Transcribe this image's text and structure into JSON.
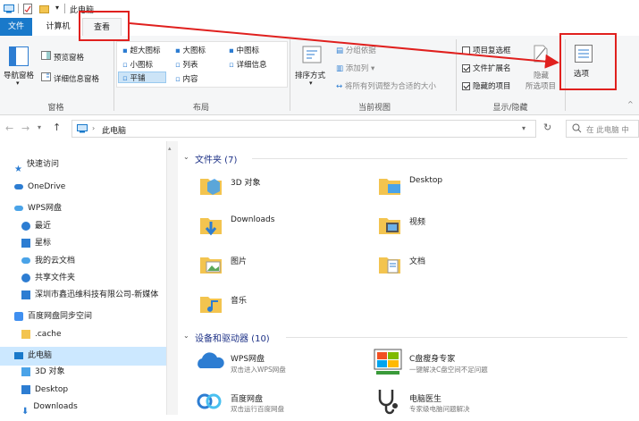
{
  "window": {
    "title": "此电脑"
  },
  "tabs": [
    "文件",
    "计算机",
    "查看"
  ],
  "ribbon": {
    "panes": {
      "nav_pane": "导航窗格",
      "preview_pane": "预览窗格",
      "details_pane": "详细信息窗格",
      "group_label": "窗格"
    },
    "layout": {
      "items": [
        "超大图标",
        "大图标",
        "中图标",
        "小图标",
        "列表",
        "详细信息",
        "平铺",
        "内容"
      ],
      "group_label": "布局"
    },
    "current_view": {
      "sort": "排序方式",
      "group_by": "分组依据",
      "add_column": "添加列",
      "fit_columns": "将所有列调整为合适的大小",
      "group_label": "当前视图"
    },
    "show_hide": {
      "item_checkbox": "项目复选框",
      "file_ext": "文件扩展名",
      "hidden_items": "隐藏的项目",
      "item_checkbox_on": false,
      "file_ext_on": true,
      "hidden_items_on": true,
      "hide_selected": "隐藏",
      "hide_selected_sub": "所选项目",
      "group_label": "显示/隐藏"
    },
    "options": "选项"
  },
  "address": {
    "path": "此电脑",
    "search_placeholder": "在 此电脑 中"
  },
  "sidebar": {
    "items": [
      "快速访问",
      "OneDrive",
      "WPS网盘",
      "最近",
      "星标",
      "我的云文档",
      "共享文件夹",
      "深圳市鑫迅维科技有限公司-新媒体",
      "百度网盘同步空间",
      ".cache",
      "此电脑",
      "3D 对象",
      "Desktop",
      "Downloads"
    ]
  },
  "content": {
    "folders_header": "文件夹 (7)",
    "folders": [
      "3D 对象",
      "Desktop",
      "Downloads",
      "视频",
      "图片",
      "文档",
      "音乐"
    ],
    "devices_header": "设备和驱动器 (10)",
    "devices": [
      {
        "name": "WPS网盘",
        "desc": "双击进入WPS网盘"
      },
      {
        "name": "C盘瘦身专家",
        "desc": "一键解决C盘空间不足问题"
      },
      {
        "name": "百度网盘",
        "desc": "双击运行百度网盘"
      },
      {
        "name": "电脑医生",
        "desc": "专家级电脑问题解决"
      }
    ]
  },
  "colors": {
    "accent": "#1979ca",
    "highlight": "#e0201e",
    "folder": "#f3c44f"
  }
}
